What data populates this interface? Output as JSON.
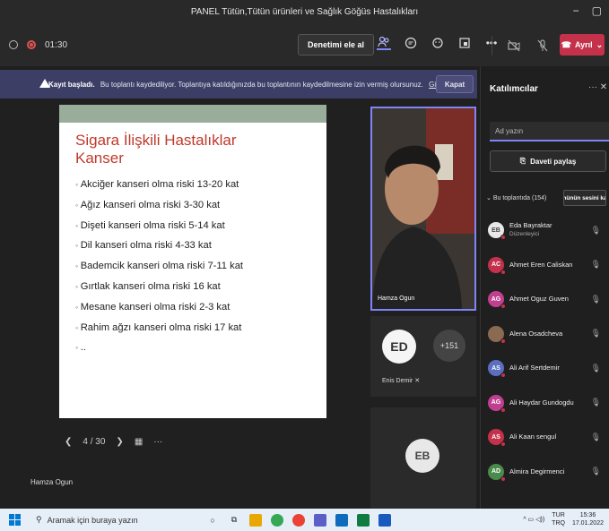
{
  "window": {
    "title": "PANEL Tütün,Tütün ürünleri ve Sağlık Göğüs Hastalıkları"
  },
  "toolbar": {
    "timer": "01:30",
    "take_control_label": "Denetimi ele al",
    "leave_label": "Ayrıl"
  },
  "banner": {
    "bold": "Kayıt başladı.",
    "text": "Bu toplantı kaydediliyor. Toplantıya katıldığınızda bu toplantının kaydedilmesine izin vermiş olursunuz.",
    "link": "Gizlilik ilkesi",
    "close_label": "Kapat"
  },
  "slide": {
    "title_line1": "Sigara İlişkili Hastalıklar",
    "title_line2": "Kanser",
    "items": [
      "Akciğer kanseri olma riski 13-20 kat",
      "Ağız kanseri olma riski 3-30 kat",
      "Dişeti kanseri olma riski 5-14 kat",
      "Dil kanseri olma riski 4-33 kat",
      "Bademcik kanseri olma riski 7-11 kat",
      "Gırtlak kanseri olma riski 16 kat",
      "Mesane kanseri olma riski 2-3 kat",
      "Rahim ağzı kanseri olma riski 17 kat",
      ".."
    ],
    "page": "4 / 30"
  },
  "stage": {
    "presenter_name": "Hamza Ogun",
    "video_name": "Hamza Ogun",
    "tile2_initials": "ED",
    "tile2_name": "Enis Demir",
    "more_count": "+151",
    "tile3_initials": "EB"
  },
  "sidebar": {
    "title": "Katılımcılar",
    "search_placeholder": "Ad yazın",
    "share_label": "Daveti paylaş",
    "in_meeting": "Bu toplantıda (154)",
    "mute_all_label": "Tümünün sesini kapat",
    "participants": [
      {
        "initials": "EB",
        "name": "Eda Bayraktar",
        "role": "Düzenleyici",
        "color": "#e8e8e8"
      },
      {
        "initials": "AC",
        "name": "Ahmet Eren Caliskan",
        "role": "",
        "color": "#c4314b"
      },
      {
        "initials": "AG",
        "name": "Ahmet Oguz Guven",
        "role": "",
        "color": "#c04090"
      },
      {
        "initials": "",
        "name": "Alena Osadcheva",
        "role": "",
        "color": "#8a6a50"
      },
      {
        "initials": "AS",
        "name": "Ali Arif Sertdemir",
        "role": "",
        "color": "#5b6ec0"
      },
      {
        "initials": "AG",
        "name": "Ali Haydar Gundogdu",
        "role": "",
        "color": "#c04090"
      },
      {
        "initials": "AS",
        "name": "Ali Kaan sengul",
        "role": "",
        "color": "#c4314b"
      },
      {
        "initials": "AD",
        "name": "Almira Degirmenci",
        "role": "",
        "color": "#4a8a4a"
      }
    ]
  },
  "taskbar": {
    "search_placeholder": "Aramak için buraya yazın",
    "lang1": "TUR",
    "lang2": "TRQ",
    "time": "15:36",
    "date": "17.01.2022"
  }
}
